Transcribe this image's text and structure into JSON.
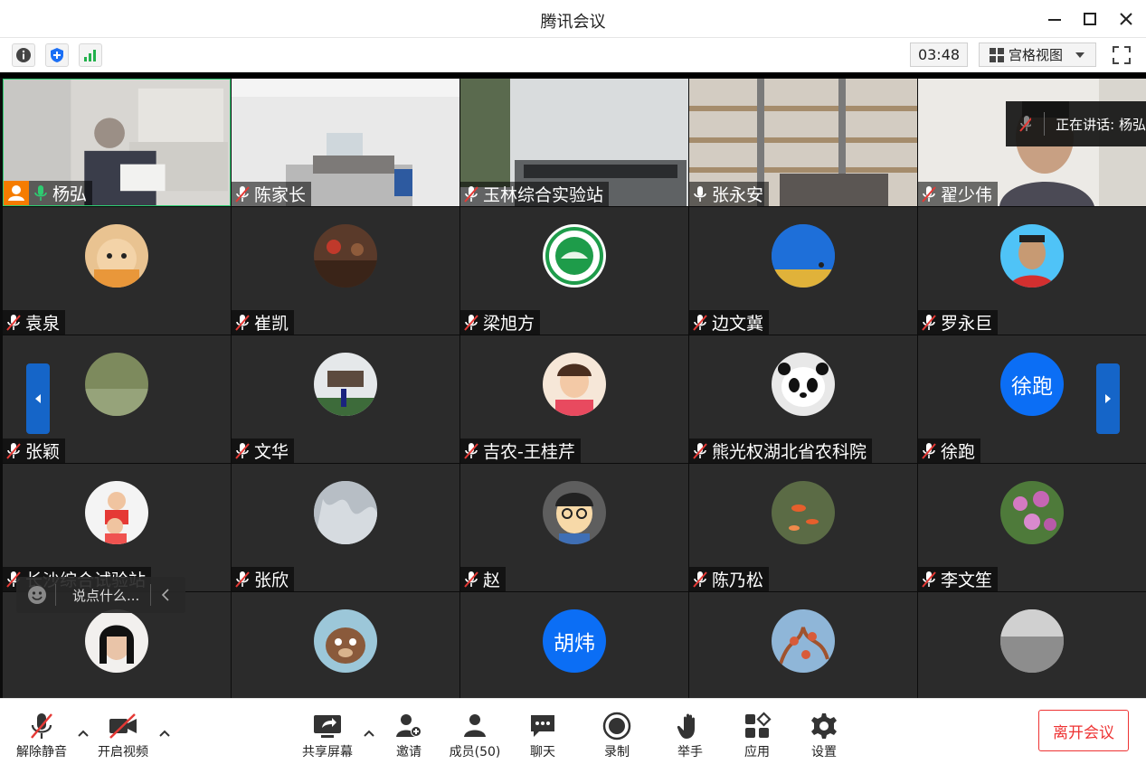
{
  "window": {
    "title": "腾讯会议"
  },
  "toolbar": {
    "timer": "03:48",
    "view_label": "宫格视图"
  },
  "speaking": {
    "label": "正在讲话: 杨弘"
  },
  "chat": {
    "placeholder": "说点什么..."
  },
  "participants": [
    {
      "name": "杨弘"
    },
    {
      "name": "陈家长"
    },
    {
      "name": "玉林综合实验站"
    },
    {
      "name": "张永安"
    },
    {
      "name": "翟少伟"
    },
    {
      "name": "袁泉"
    },
    {
      "name": "崔凯"
    },
    {
      "name": "梁旭方"
    },
    {
      "name": "边文冀"
    },
    {
      "name": "罗永巨"
    },
    {
      "name": "张颖"
    },
    {
      "name": "文华"
    },
    {
      "name": "吉农-王桂芹"
    },
    {
      "name": "熊光权湖北省农科院"
    },
    {
      "name": "徐跑",
      "avatar_text": "徐跑"
    },
    {
      "name": "长沙综合试验站"
    },
    {
      "name": "张欣"
    },
    {
      "name": "赵"
    },
    {
      "name": "陈乃松"
    },
    {
      "name": "李文笙"
    },
    {
      "name": ""
    },
    {
      "name": ""
    },
    {
      "name": "",
      "avatar_text": "胡炜"
    },
    {
      "name": ""
    },
    {
      "name": ""
    }
  ],
  "bottom": {
    "unmute": "解除静音",
    "start_video": "开启视频",
    "share": "共享屏幕",
    "invite": "邀请",
    "members": "成员(50)",
    "chat": "聊天",
    "record": "录制",
    "raise_hand": "举手",
    "apps": "应用",
    "settings": "设置",
    "leave": "离开会议"
  },
  "colors": {
    "accent": "#0b6ef5",
    "leave": "#e33333",
    "tile_bg": "#2b2b2b",
    "active_border": "#2ecc71"
  }
}
